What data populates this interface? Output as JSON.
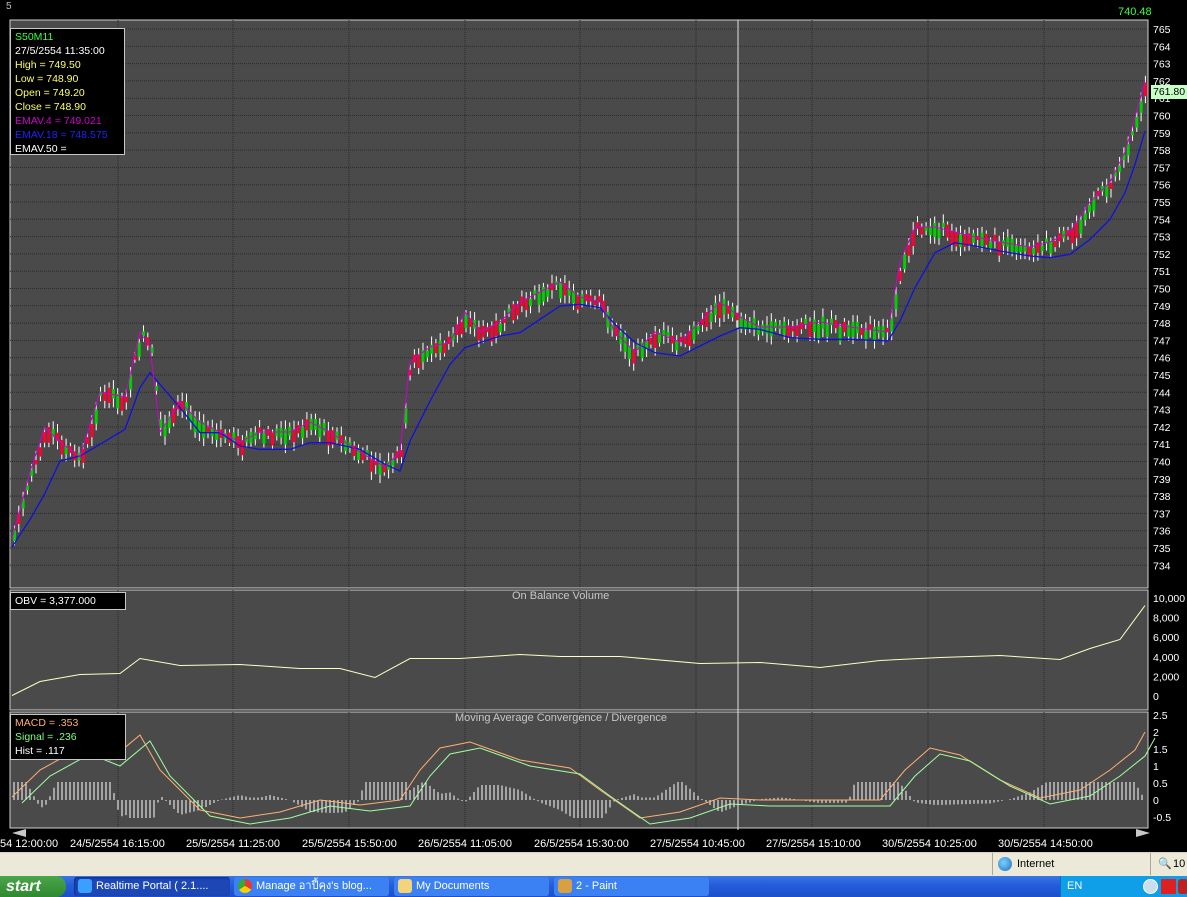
{
  "window": {
    "corner_label": "5"
  },
  "price_panel": {
    "top_value": "740.48",
    "current_price": "761.80",
    "axis_ticks": [
      "765",
      "764",
      "763",
      "762",
      "761",
      "760",
      "759",
      "758",
      "757",
      "756",
      "755",
      "754",
      "753",
      "752",
      "751",
      "750",
      "749",
      "748",
      "747",
      "746",
      "745",
      "744",
      "743",
      "742",
      "741",
      "740",
      "739",
      "738",
      "737",
      "736",
      "735",
      "734"
    ],
    "info": {
      "symbol": "S50M11",
      "datetime": "27/5/2554 11:35:00",
      "high": "High  = 749.50",
      "low": "Low  = 748.90",
      "open": "Open = 749.20",
      "close": "Close = 748.90",
      "ema4": "EMAV.4 = 749.021",
      "ema18": "EMAV.18 = 748.575",
      "ema50": "EMAV.50 ="
    },
    "colors": {
      "up": "#00d000",
      "down": "#ff0030",
      "ema4": "#d000d0",
      "ema18": "#1010e0",
      "text_yellow": "#ffff60",
      "text_green": "#40ff40"
    }
  },
  "obv_panel": {
    "title": "On Balance Volume",
    "info": "OBV = 3,377.000",
    "axis_ticks": [
      "10,000",
      "8,000",
      "6,000",
      "4,000",
      "2,000",
      "0"
    ]
  },
  "macd_panel": {
    "title": "Moving Average Convergence / Divergence",
    "info": {
      "macd": "MACD = .353",
      "signal": "Signal = .236",
      "hist": "Hist = .117"
    },
    "axis_ticks": [
      "2.5",
      "2",
      "1.5",
      "1",
      "0.5",
      "0",
      "-0.5"
    ]
  },
  "time_axis": {
    "labels": [
      "54 12:00:00",
      "24/5/2554 16:15:00",
      "25/5/2554 11:25:00",
      "25/5/2554 15:50:00",
      "26/5/2554 11:05:00",
      "26/5/2554 15:30:00",
      "27/5/2554 10:45:00",
      "27/5/2554 15:10:00",
      "30/5/2554 10:25:00",
      "30/5/2554 14:50:00"
    ]
  },
  "status_bar": {
    "zone": "Internet",
    "zoom": "10"
  },
  "taskbar": {
    "start_label": "start",
    "tasks": [
      {
        "label": "Realtime Portal ( 2.1....",
        "icon": "ie-icon",
        "active": true
      },
      {
        "label": "Manage อาปี้คุง's blog...",
        "icon": "chrome-icon",
        "active": false
      },
      {
        "label": "My Documents",
        "icon": "folder-icon",
        "active": false
      },
      {
        "label": "2 - Paint",
        "icon": "paint-icon",
        "active": false
      }
    ],
    "language": "EN"
  }
}
